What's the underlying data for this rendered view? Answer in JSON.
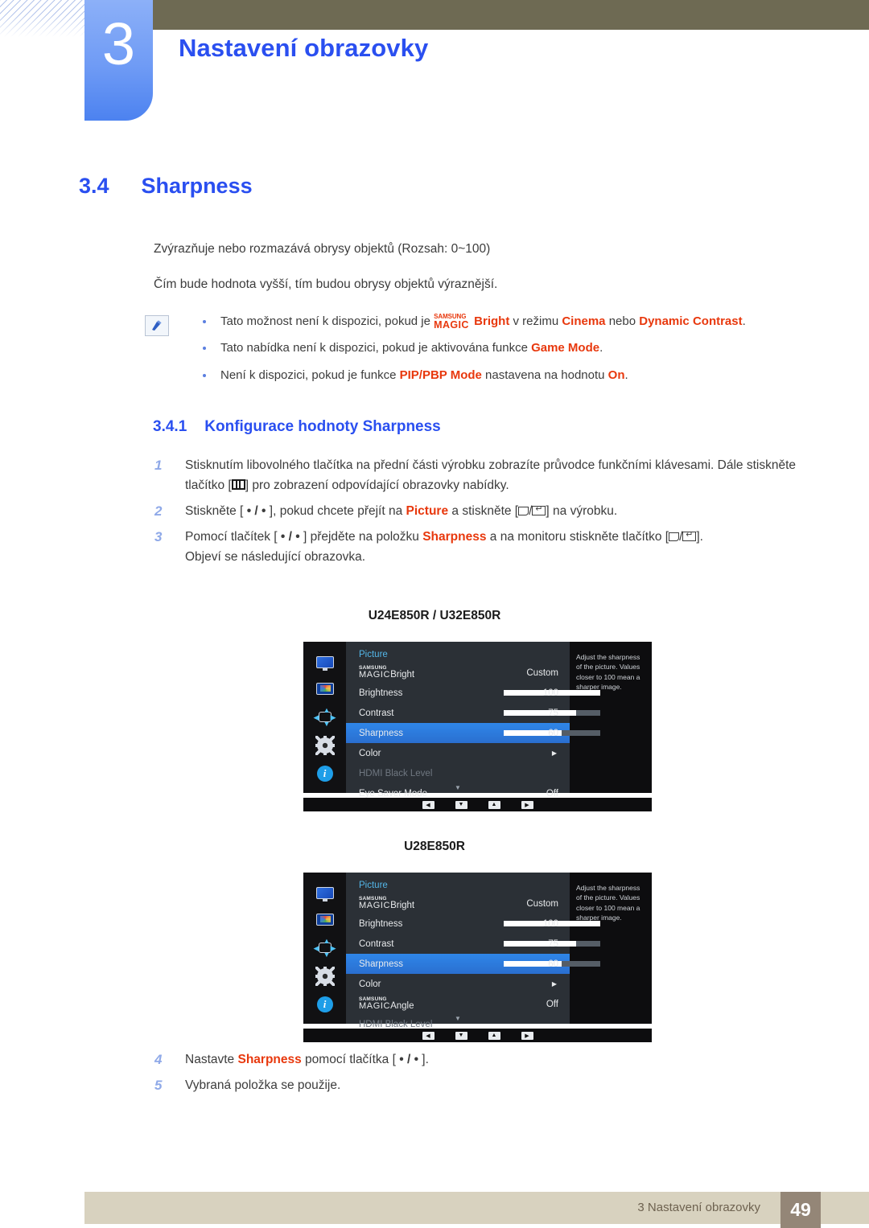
{
  "header": {
    "chapter_number": "3",
    "chapter_title": "Nastavení obrazovky"
  },
  "section": {
    "number": "3.4",
    "title": "Sharpness"
  },
  "intro": {
    "line1": "Zvýrazňuje nebo rozmazává obrysy objektů (Rozsah: 0~100)",
    "line2": "Čím bude hodnota vyšší, tím budou obrysy objektů výraznější."
  },
  "note": {
    "icon": "note-pencil-icon",
    "bullets": [
      {
        "pre": "Tato možnost není k dispozici, pokud je ",
        "magic_top": "SAMSUNG",
        "magic_bottom": "MAGIC",
        "magic_suffix": "Bright",
        "mid": " v režimu ",
        "hl1": "Cinema",
        "mid2": " nebo ",
        "hl2": "Dynamic Contrast",
        "post": "."
      },
      {
        "pre": "Tato nabídka není k dispozici, pokud je aktivována funkce ",
        "hl1": "Game Mode",
        "post": "."
      },
      {
        "pre": "Není k dispozici, pokud je funkce ",
        "hl1": "PIP/PBP Mode",
        "mid": " nastavena na hodnotu ",
        "hl2": "On",
        "post": "."
      }
    ]
  },
  "subsection": {
    "number": "3.4.1",
    "title": "Konfigurace hodnoty Sharpness"
  },
  "steps": [
    {
      "num": "1",
      "part1": "Stisknutím libovolného tlačítka na přední části výrobku zobrazíte průvodce funkčními klávesami. Dále stiskněte tlačítko [",
      "icon1": "menu-button-icon",
      "part2": "] pro zobrazení odpovídající obrazovky nabídky."
    },
    {
      "num": "2",
      "part1": "Stiskněte [ ",
      "dots": "• / •",
      "part2": " ], pokud chcete přejít na ",
      "hl": "Picture",
      "part3": " a stiskněte [",
      "icon1": "source-button-icon",
      "sep": "/",
      "icon2": "enter-button-icon",
      "part4": "] na výrobku."
    },
    {
      "num": "3",
      "part1": "Pomocí tlačítek [ ",
      "dots": "• / •",
      "part2": " ] přejděte na položku ",
      "hl": "Sharpness",
      "part3": " a na monitoru stiskněte tlačítko [",
      "icon1": "source-button-icon",
      "sep": "/",
      "icon2": "enter-button-icon",
      "part4": "].",
      "sub": "Objeví se následující obrazovka."
    }
  ],
  "steps_after": [
    {
      "num": "4",
      "part1": "Nastavte ",
      "hl": "Sharpness",
      "part2": " pomocí tlačítka [ ",
      "dots": "• / •",
      "part3": " ]."
    },
    {
      "num": "5",
      "part1": "Vybraná položka se použije."
    }
  ],
  "osd_1": {
    "model_label": "U24E850R / U32E850R",
    "menu_title": "Picture",
    "rail_icons": [
      "monitor-icon",
      "picture-icon",
      "screen-adjust-icon",
      "system-gear-icon",
      "information-icon"
    ],
    "help_text": "Adjust the sharpness of the picture. Values closer to 100 mean a sharper image.",
    "rows": [
      {
        "label_top": "SAMSUNG",
        "label_bottom": "MAGIC",
        "label_suffix": "Bright",
        "value": "Custom",
        "type": "magic"
      },
      {
        "label": "Brightness",
        "value": "100",
        "type": "slider",
        "fill": 100
      },
      {
        "label": "Contrast",
        "value": "75",
        "type": "slider",
        "fill": 75
      },
      {
        "label": "Sharpness",
        "value": "60",
        "type": "slider",
        "fill": 60,
        "selected": true
      },
      {
        "label": "Color",
        "value": "▶",
        "type": "submenu"
      },
      {
        "label": "HDMI Black Level",
        "value": "",
        "type": "disabled"
      },
      {
        "label": "Eye Saver Mode",
        "value": "Off",
        "type": "value"
      }
    ],
    "footer_buttons": [
      "◀",
      "▼",
      "▲",
      "▶"
    ]
  },
  "osd_2": {
    "model_label": "U28E850R",
    "menu_title": "Picture",
    "rail_icons": [
      "monitor-icon",
      "picture-icon",
      "screen-adjust-icon",
      "system-gear-icon",
      "information-icon"
    ],
    "help_text": "Adjust the sharpness of the picture. Values closer to 100 mean a sharper image.",
    "rows": [
      {
        "label_top": "SAMSUNG",
        "label_bottom": "MAGIC",
        "label_suffix": "Bright",
        "value": "Custom",
        "type": "magic"
      },
      {
        "label": "Brightness",
        "value": "100",
        "type": "slider",
        "fill": 100
      },
      {
        "label": "Contrast",
        "value": "75",
        "type": "slider",
        "fill": 75
      },
      {
        "label": "Sharpness",
        "value": "60",
        "type": "slider",
        "fill": 60,
        "selected": true
      },
      {
        "label": "Color",
        "value": "▶",
        "type": "submenu"
      },
      {
        "label_top": "SAMSUNG",
        "label_bottom": "MAGIC",
        "label_suffix": "Angle",
        "value": "Off",
        "type": "magic"
      },
      {
        "label": "HDMI Black Level",
        "value": "",
        "type": "disabled"
      }
    ],
    "footer_buttons": [
      "◀",
      "▼",
      "▲",
      "▶"
    ]
  },
  "footer": {
    "text": "3 Nastavení obrazovky",
    "page": "49"
  },
  "colors": {
    "heading_blue": "#2a4ff0",
    "highlight_red": "#e8380d",
    "header_brown": "#6e6a53",
    "footer_tan": "#d8d2bf",
    "page_badge": "#948677",
    "osd_select_blue": "#2f86e8"
  }
}
